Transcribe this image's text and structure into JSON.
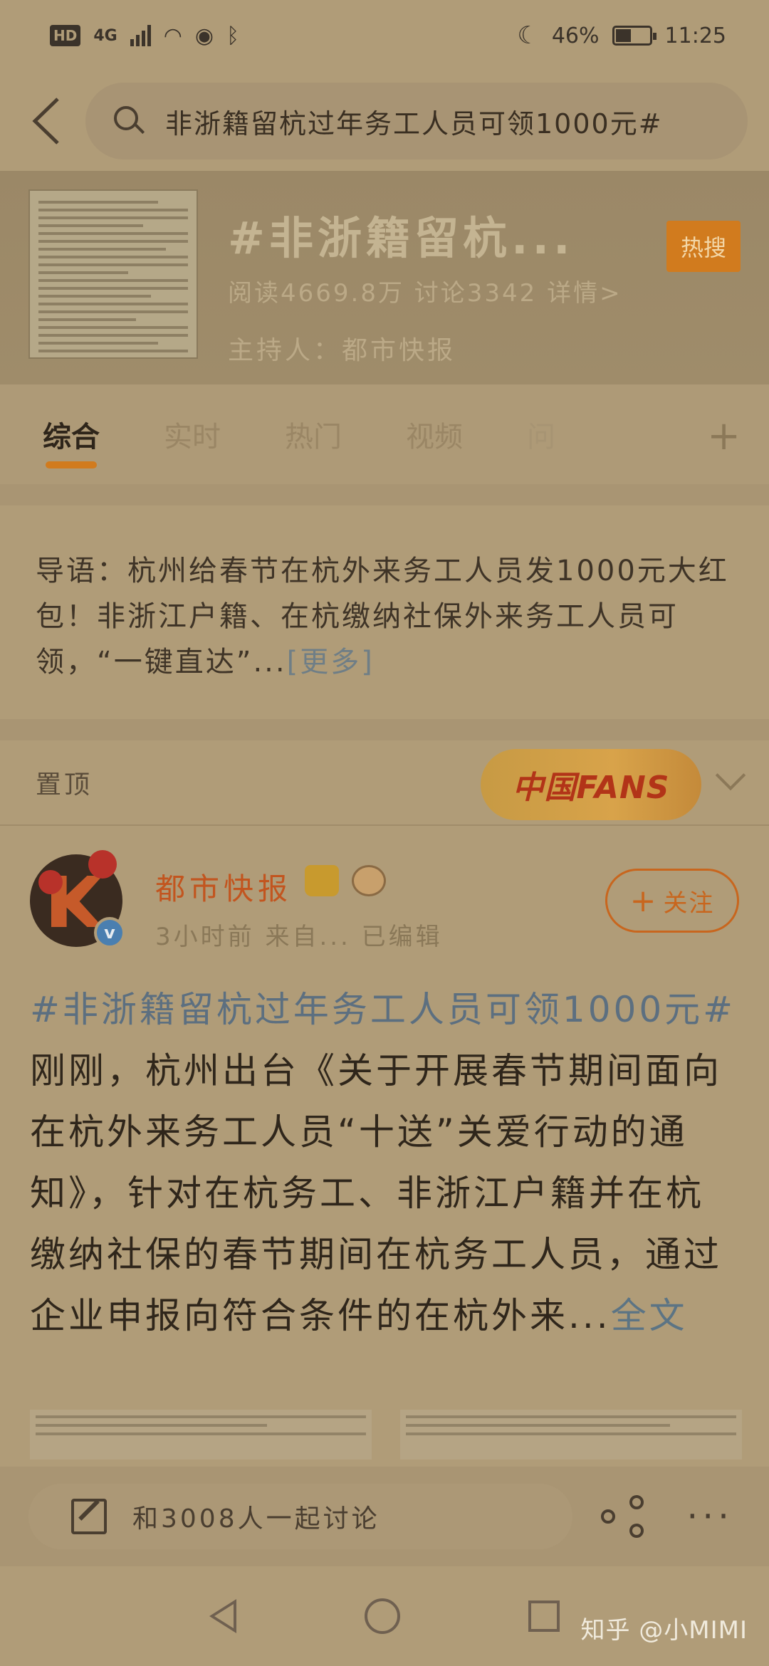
{
  "status_bar": {
    "hd": "HD",
    "network": "4G",
    "battery_percent": "46%",
    "battery_level": 0.46,
    "time": "11:25"
  },
  "search": {
    "query": "非浙籍留杭过年务工人员可领1000元#"
  },
  "topic": {
    "title": "#非浙籍留杭...",
    "stats": "阅读4669.8万  讨论3342  详情>",
    "host": "主持人：都市快报",
    "hot_badge": "热搜"
  },
  "tabs": [
    {
      "label": "综合",
      "active": true
    },
    {
      "label": "实时",
      "active": false
    },
    {
      "label": "热门",
      "active": false
    },
    {
      "label": "视频",
      "active": false
    },
    {
      "label": "问",
      "active": false
    }
  ],
  "tab_add": "+",
  "intro": {
    "text": "导语：杭州给春节在杭外来务工人员发1000元大红包！非浙江户籍、在杭缴纳社保外来务工人员可领，“一键直达”...",
    "more": "[更多]"
  },
  "pinned": {
    "label": "置顶",
    "banner_text": "中国FANS"
  },
  "post": {
    "author": "都市快报",
    "verified": "v",
    "meta": "3小时前  来自...  已编辑",
    "follow_label": "关注",
    "follow_plus": "+",
    "hashtag": "#非浙籍留杭过年务工人员可领1000元#",
    "body": "刚刚，杭州出台《关于开展春节期间面向在杭外来务工人员“十送”关爱行动的通知》，针对在杭务工、非浙江户籍并在杭缴纳社保的春节期间在杭务工人员，通过企业申报向符合条件的在杭外来...",
    "full_text": "全文"
  },
  "comment_bar": {
    "placeholder": "和3008人一起讨论",
    "more": "···"
  },
  "watermark": "知乎 @小MIMI"
}
